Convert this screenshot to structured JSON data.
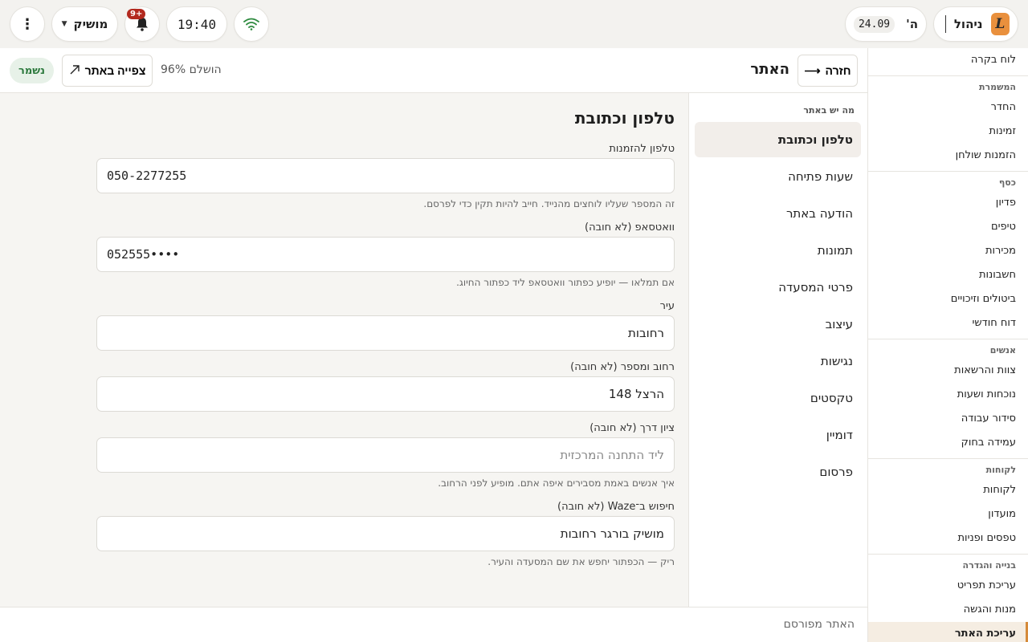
{
  "topbar": {
    "brand": {
      "label": "ניהול",
      "logo_glyph": "L",
      "logo_color": "#e9903d"
    },
    "date": {
      "day": "ה'",
      "date": "24.09"
    },
    "time": "19:40",
    "notifications": {
      "badge": "9+"
    },
    "store": {
      "label": "מושיק"
    },
    "icons": {
      "wifi": "wifi-icon",
      "bell": "bell-icon",
      "more": "more-vertical-icon",
      "caret": "caret-down-icon"
    }
  },
  "sidebar": {
    "top_item": "לוח בקרה",
    "groups": [
      {
        "heading": "המשמרת",
        "items": [
          "החדר",
          "זמינות",
          "הזמנות שולחן"
        ]
      },
      {
        "heading": "כסף",
        "items": [
          "פדיון",
          "טיפים",
          "מכירות",
          "חשבונות",
          "ביטולים וזיכויים",
          "דוח חודשי"
        ]
      },
      {
        "heading": "אנשים",
        "items": [
          "צוות והרשאות",
          "נוכחות ושעות",
          "סידור עבודה",
          "עמידה בחוק"
        ]
      },
      {
        "heading": "לקוחות",
        "items": [
          "לקוחות",
          "מועדון",
          "טפסים ופניות"
        ]
      },
      {
        "heading": "בנייה והגדרה",
        "items": [
          "עריכת תפריט",
          "מנות והגשה",
          "עריכת האתר"
        ]
      }
    ],
    "active_item": "עריכת האתר",
    "accent_color": "#d58a3a"
  },
  "header": {
    "back_label": "חזרה",
    "title": "האתר",
    "completion": "הושלם 96%",
    "view_site_label": "צפייה באתר",
    "saved_label": "נשמר"
  },
  "section_nav": {
    "heading": "מה יש באתר",
    "items": [
      "טלפון וכתובת",
      "שעות פתיחה",
      "הודעה באתר",
      "תמונות",
      "פרטי המסעדה",
      "עיצוב",
      "נגישות",
      "טקסטים",
      "דומיין",
      "פרסום"
    ],
    "active_index": 0
  },
  "form": {
    "title": "טלפון וכתובת",
    "fields": [
      {
        "label": "טלפון להזמנות",
        "value": "050-2277255",
        "placeholder": "",
        "help": "זה המספר שעליו לוחצים מהנייד. חייב להיות תקין כדי לפרסם.",
        "ltr": true
      },
      {
        "label": "וואטסאפ (לא חובה)",
        "value": "052555••••",
        "placeholder": "",
        "help": "אם תמלאו — יופיע כפתור וואטסאפ ליד כפתור החיוג.",
        "ltr": true
      },
      {
        "label": "עיר",
        "value": "רחובות",
        "placeholder": "",
        "help": "",
        "ltr": false
      },
      {
        "label": "רחוב ומספר (לא חובה)",
        "value": "הרצל 148",
        "placeholder": "",
        "help": "",
        "ltr": false
      },
      {
        "label": "ציון דרך (לא חובה)",
        "value": "",
        "placeholder": "ליד התחנה המרכזית",
        "help": "איך אנשים באמת מסבירים איפה אתם. מופיע לפני הרחוב.",
        "ltr": false
      },
      {
        "label": "חיפוש ב־Waze (לא חובה)",
        "value": "מושיק בורגר רחובות",
        "placeholder": "",
        "help": "ריק — הכפתור יחפש את שם המסעדה והעיר.",
        "ltr": false
      }
    ]
  },
  "footer": {
    "text": "האתר מפורסם"
  },
  "colors": {
    "saved_bg": "#e7f1e8",
    "saved_text": "#2d7a3e",
    "badge_red": "#b32a1f"
  }
}
